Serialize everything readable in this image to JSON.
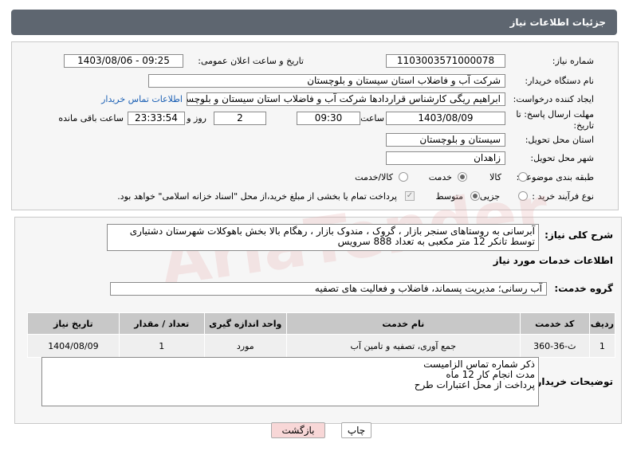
{
  "header": {
    "title": "جزئیات اطلاعات نیاز"
  },
  "form": {
    "need_number_label": "شماره نیاز:",
    "need_number": "1103003571000078",
    "announce_label": "تاریخ و ساعت اعلان عمومی:",
    "announce_value": "1403/08/06 - 09:25",
    "buyer_org_label": "نام دستگاه خریدار:",
    "buyer_org": "شرکت آب و فاضلاب استان سیستان و بلوچستان",
    "creator_label": "ایجاد کننده درخواست:",
    "creator": "ابراهیم ریگی کارشناس قراردادها شرکت آب و فاضلاب استان سیستان و بلوچستان",
    "contact_link": "اطلاعات تماس خریدار",
    "deadline_label": "مهلت ارسال پاسخ: تا تاریخ:",
    "deadline_date": "1403/08/09",
    "time_label": "ساعت",
    "deadline_time": "09:30",
    "days_value": "2",
    "days_label": "روز و",
    "remaining_value": "23:33:54",
    "remaining_label": "ساعت باقی مانده",
    "province_label": "استان محل تحویل:",
    "province": "سیستان و بلوچستان",
    "city_label": "شهر محل تحویل:",
    "city": "زاهدان",
    "category_label": "طبقه بندی موضوعی:",
    "category_options": [
      "کالا",
      "خدمت",
      "کالا/خدمت"
    ],
    "category_selected": "خدمت",
    "process_label": "نوع فرآیند خرید :",
    "process_options": [
      "جزیی",
      "متوسط"
    ],
    "process_selected": "متوسط",
    "payment_note": "پرداخت تمام یا بخشی از مبلغ خرید،از محل \"اسناد خزانه اسلامی\" خواهد بود."
  },
  "description": {
    "label": "شرح کلی نیاز:",
    "text": "آبرسانی به روستاهای سنجر بازار ، گروک ، مندوک بازار ، رهگام بالا بخش باهوکلات شهرستان دشتیاری توسط تانکر 12 متر مکعبی به تعداد 888 سرویس"
  },
  "services": {
    "section_title": "اطلاعات خدمات مورد نیاز",
    "group_label": "گروه خدمت:",
    "group_value": "آب رسانی؛ مدیریت پسماند، فاضلاب و فعالیت های تصفیه",
    "columns": [
      "ردیف",
      "کد خدمت",
      "نام خدمت",
      "واحد اندازه گیری",
      "تعداد / مقدار",
      "تاریخ نیاز"
    ],
    "rows": [
      [
        "1",
        "ث-36-360",
        "جمع آوری، تصفیه و تامین آب",
        "مورد",
        "1",
        "1404/08/09"
      ]
    ]
  },
  "buyer_notes": {
    "label": "توضیحات خریدار:",
    "lines": [
      "ذکر شماره تماس الزامیست",
      "مدت انجام کار 12 ماه",
      "پرداخت از محل اعتبارات طرح"
    ]
  },
  "buttons": {
    "print": "چاپ",
    "back": "بازگشت"
  },
  "colors": {
    "title_bar": "#5e6670",
    "back_button": "#f8d7d7",
    "print_button": "#ffffff",
    "link": "#1a5fb4"
  }
}
